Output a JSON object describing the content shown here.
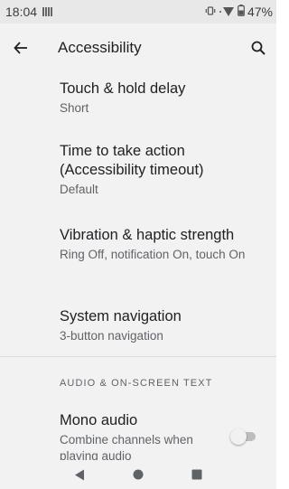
{
  "status_bar": {
    "time": "18:04",
    "battery": "47%",
    "icons": [
      "notification-icon",
      "vibrate-icon",
      "wifi-icon",
      "battery-icon"
    ]
  },
  "app_bar": {
    "title": "Accessibility",
    "back_icon": "back-arrow-icon",
    "search_icon": "search-icon"
  },
  "settings": [
    {
      "title": "Touch & hold delay",
      "summary": "Short"
    },
    {
      "title": "Time to take action\n(Accessibility timeout)",
      "summary": "Default"
    },
    {
      "title": "Vibration & haptic strength",
      "summary": "Ring Off, notification On, touch On"
    },
    {
      "title": "System navigation",
      "summary": "3-button navigation"
    }
  ],
  "section": {
    "header": "AUDIO & ON-SCREEN TEXT"
  },
  "mono_audio": {
    "title": "Mono audio",
    "summary": "Combine channels when playing audio",
    "toggle_on": false
  },
  "nav_bar": {
    "icons": [
      "back-triangle-icon",
      "home-circle-icon",
      "recents-square-icon"
    ]
  }
}
